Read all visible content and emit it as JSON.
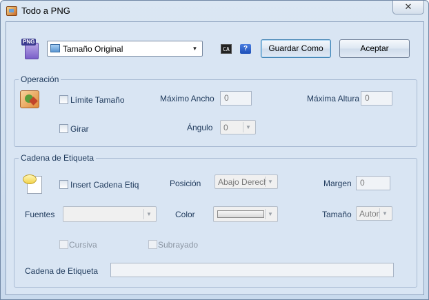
{
  "window": {
    "title": "Todo a PNG",
    "close_glyph": "✕"
  },
  "toolbar": {
    "png_tag": "PNG",
    "size_select": "Tamaño Original",
    "ca_label": "CA",
    "help_label": "?",
    "save_as_label": "Guardar Como",
    "accept_label": "Aceptar"
  },
  "operation": {
    "group_title": "Operación",
    "limit_size_label": "Límite Tamaño",
    "max_width_label": "Máximo Ancho",
    "max_width_value": "0",
    "max_height_label": "Máxima Altura",
    "max_height_value": "0",
    "rotate_label": "Girar",
    "angle_label": "Ángulo",
    "angle_value": "0"
  },
  "tag_chain": {
    "group_title": "Cadena de Etiqueta",
    "insert_label": "Insert Cadena Etiq",
    "position_label": "Posición",
    "position_value": "Abajo Derecha",
    "margin_label": "Margen",
    "margin_value": "0",
    "fonts_label": "Fuentes",
    "fonts_value": "",
    "color_label": "Color",
    "size_label": "Tamaño",
    "size_value": "Automático",
    "italic_label": "Cursiva",
    "underline_label": "Subrayado",
    "chain_label": "Cadena de Etiqueta",
    "chain_value": ""
  }
}
